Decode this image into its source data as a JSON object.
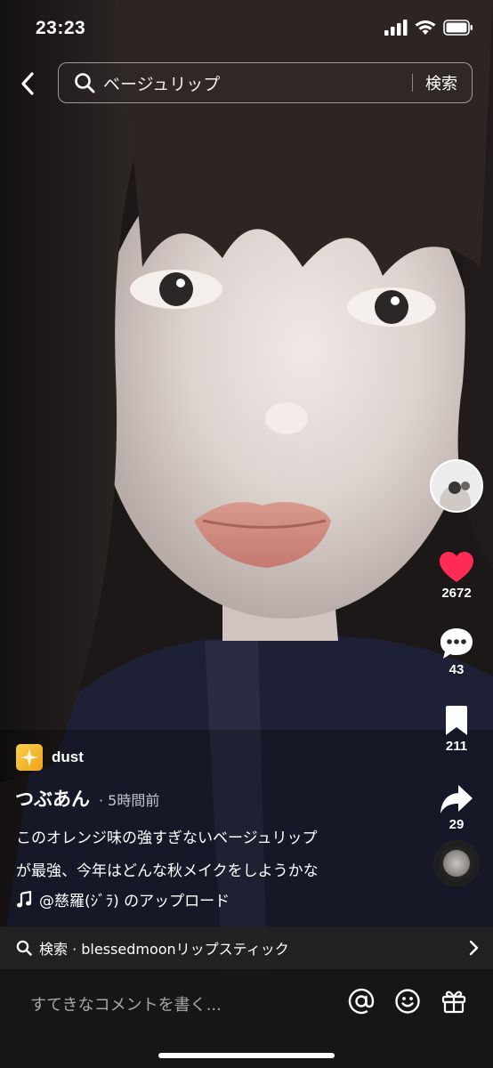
{
  "status_bar": {
    "time": "23:23"
  },
  "search": {
    "query": "ベージュリップ",
    "submit_label": "検索"
  },
  "actions": {
    "likes": "2672",
    "comments": "43",
    "saves": "211",
    "shares": "29",
    "like_color": "#fe2c55"
  },
  "post": {
    "effect_name": "dust",
    "author": "つぶあん",
    "time_ago": "· 5時間前",
    "caption_line1": "このオレンジ味の強すぎないベージュリップ",
    "caption_line2": "が最強、今年はどんな秋メイクをしようかな",
    "sound": "@慈羅(ｼﾞﾗ) のアップロード"
  },
  "related_search": {
    "text": "検索 · blessedmoonリップスティック"
  },
  "comment_bar": {
    "placeholder": "すてきなコメントを書く..."
  },
  "icons": {
    "back": "chevron-left-icon",
    "search": "magnifier-icon",
    "like": "heart-icon",
    "comment": "speech-bubble-icon",
    "save": "bookmark-icon",
    "share": "share-arrow-icon",
    "sound": "music-note-icon",
    "mention": "at-sign-icon",
    "emoji": "smiley-icon",
    "gift": "gift-icon"
  }
}
